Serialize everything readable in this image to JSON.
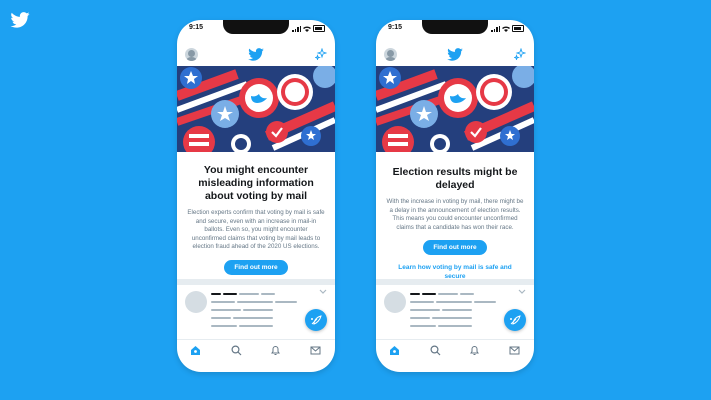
{
  "brand": {
    "icon": "twitter-bird-icon",
    "color": "#ffffff"
  },
  "colors": {
    "background": "#1da1f2",
    "accent": "#1da1f2",
    "headline": "#14171a",
    "body_text": "#657786"
  },
  "phones": [
    {
      "status_time": "9:15",
      "headline": "You might encounter misleading information about voting by mail",
      "body": "Election experts confirm that voting by mail is safe and secure, even with an increase in mail-in ballots. Even so, you might encounter unconfirmed claims that voting by mail leads to election fraud ahead of the 2020 US elections.",
      "cta_label": "Find out more",
      "link": ""
    },
    {
      "status_time": "9:15",
      "headline": "Election results might be delayed",
      "body": "With the increase in voting by mail, there might be a delay in the announcement of election results. This means you could encounter unconfirmed claims that a candidate has won their race.",
      "cta_label": "Find out more",
      "link": "Learn how voting by mail is safe and secure"
    }
  ],
  "tab_icons": [
    "home-icon",
    "search-icon",
    "notifications-bell-icon",
    "messages-envelope-icon"
  ]
}
